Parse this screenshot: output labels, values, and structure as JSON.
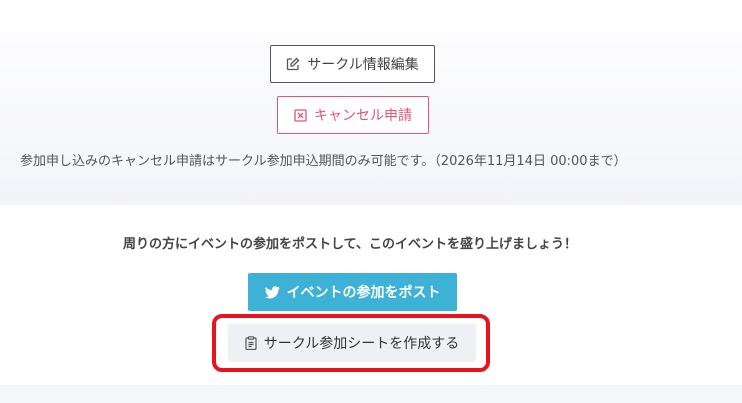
{
  "circle": {
    "edit_label": "サークル情報編集",
    "cancel_label": "キャンセル申請",
    "notice": "参加申し込みのキャンセル申請はサークル参加申込期間のみ可能です。（2026年11月14日 00:00まで）"
  },
  "share": {
    "message": "周りの方にイベントの参加をポストして、このイベントを盛り上げましょう！",
    "post_label": "イベントの参加をポスト",
    "sheet_label": "サークル参加シートを作成する"
  },
  "colors": {
    "cancel": "#e0557a",
    "post": "#3eb1d6",
    "highlight": "#e8141b"
  }
}
